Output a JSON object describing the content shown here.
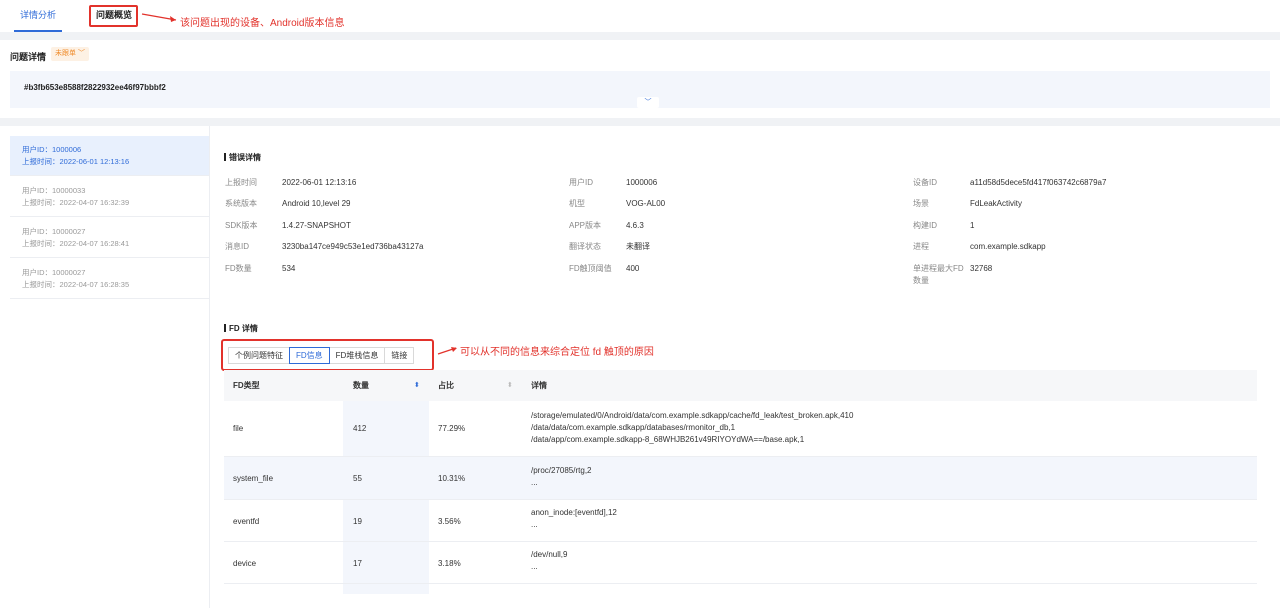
{
  "tabs": {
    "detail": "详情分析",
    "overview": "问题概览"
  },
  "annotations": {
    "top": "该问题出现的设备、Android版本信息",
    "fd": "可以从不同的信息来综合定位 fd 触顶的原因"
  },
  "issue": {
    "title": "问题详情",
    "status": "未跟单",
    "hash": "#b3fb653e8588f2822932ee46f97bbbf2"
  },
  "users": [
    {
      "id": "用户ID：1000006",
      "time": "上报时间：2022-06-01 12:13:16"
    },
    {
      "id": "用户ID：10000033",
      "time": "上报时间：2022-04-07 16:32:39"
    },
    {
      "id": "用户ID：10000027",
      "time": "上报时间：2022-04-07 16:28:41"
    },
    {
      "id": "用户ID：10000027",
      "time": "上报时间：2022-04-07 16:28:35"
    }
  ],
  "error_section": {
    "title": "错误详情",
    "col1": [
      {
        "label": "上报时间",
        "value": "2022-06-01 12:13:16"
      },
      {
        "label": "系统版本",
        "value": "Android 10,level 29"
      },
      {
        "label": "SDK版本",
        "value": "1.4.27-SNAPSHOT"
      },
      {
        "label": "消息ID",
        "value": "3230ba147ce949c53e1ed736ba43127a"
      },
      {
        "label": "FD数量",
        "value": "534"
      }
    ],
    "col2": [
      {
        "label": "用户ID",
        "value": "1000006"
      },
      {
        "label": "机型",
        "value": "VOG-AL00"
      },
      {
        "label": "APP版本",
        "value": "4.6.3"
      },
      {
        "label": "翻译状态",
        "value": "未翻译"
      },
      {
        "label": "FD触顶阈值",
        "value": "400"
      }
    ],
    "col3": [
      {
        "label": "设备ID",
        "value": "a11d58d5dece5fd417f063742c6879a7"
      },
      {
        "label": "场景",
        "value": "FdLeakActivity"
      },
      {
        "label": "构建ID",
        "value": "1"
      },
      {
        "label": "进程",
        "value": "com.example.sdkapp"
      },
      {
        "label": "单进程最大FD",
        "label2": "数量",
        "value": "32768"
      }
    ]
  },
  "fd_section": {
    "title": "FD 详情",
    "buttons": [
      "个例问题特征",
      "FD信息",
      "FD堆栈信息",
      "链接"
    ],
    "headers": {
      "type": "FD类型",
      "count": "数量",
      "ratio": "占比",
      "detail": "详情"
    },
    "rows": [
      {
        "type": "file",
        "count": "412",
        "ratio": "77.29%",
        "details": [
          "/storage/emulated/0/Android/data/com.example.sdkapp/cache/fd_leak/test_broken.apk,410",
          "/data/data/com.example.sdkapp/databases/rmonitor_db,1",
          "/data/app/com.example.sdkapp-8_68WHJB261v49RIYOYdWA==/base.apk,1"
        ]
      },
      {
        "type": "system_file",
        "count": "55",
        "ratio": "10.31%",
        "details": [
          "/proc/27085/rtg,2",
          "..."
        ]
      },
      {
        "type": "eventfd",
        "count": "19",
        "ratio": "3.56%",
        "details": [
          "anon_inode:[eventfd],12",
          "..."
        ]
      },
      {
        "type": "device",
        "count": "17",
        "ratio": "3.18%",
        "details": [
          "/dev/null,9",
          "..."
        ]
      }
    ]
  }
}
